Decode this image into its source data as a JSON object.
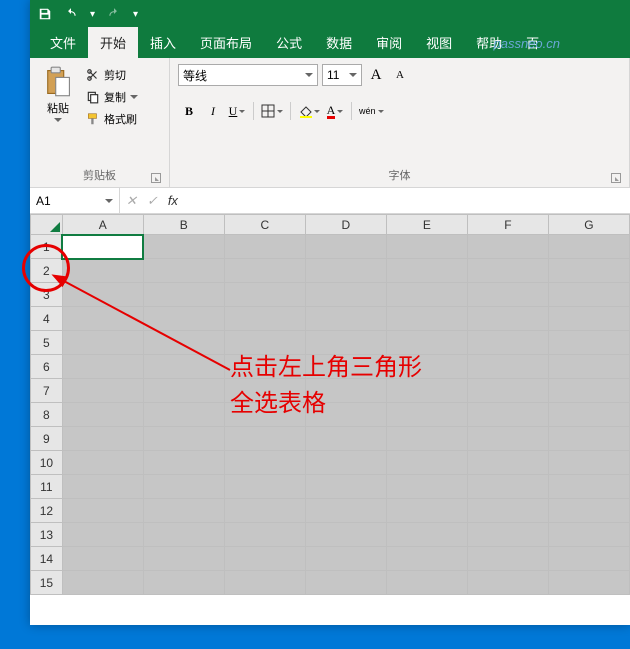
{
  "titlebar": {
    "caret": "▾"
  },
  "tabs": {
    "file": "文件",
    "home": "开始",
    "insert": "插入",
    "layout": "页面布局",
    "formulas": "公式",
    "data": "数据",
    "review": "审阅",
    "view": "视图",
    "help": "帮助",
    "baidu": "百"
  },
  "ribbon": {
    "clipboard": {
      "paste": "粘贴",
      "cut": "剪切",
      "copy": "复制",
      "format_painter": "格式刷",
      "group_label": "剪贴板"
    },
    "font": {
      "name": "等线",
      "size": "11",
      "grow": "A",
      "shrink": "A",
      "bold": "B",
      "italic": "I",
      "underline": "U",
      "font_color": "A",
      "phonetic": "wén",
      "group_label": "字体"
    }
  },
  "namebox": {
    "ref": "A1"
  },
  "watermark": "passneo.cn",
  "columns": [
    "A",
    "B",
    "C",
    "D",
    "E",
    "F",
    "G"
  ],
  "rows": [
    "1",
    "2",
    "3",
    "4",
    "5",
    "6",
    "7",
    "8",
    "9",
    "10",
    "11",
    "12",
    "13",
    "14",
    "15"
  ],
  "annotation": {
    "line1": "点击左上角三角形",
    "line2": "全选表格"
  }
}
